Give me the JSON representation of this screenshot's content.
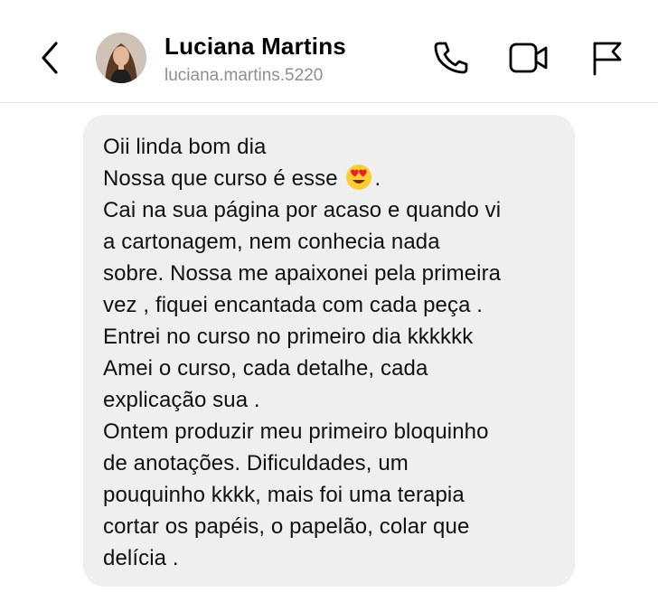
{
  "header": {
    "name": "Luciana Martins",
    "username": "luciana.martins.5220",
    "icons": [
      "chevron-left-icon",
      "phone-icon",
      "video-camera-icon",
      "flag-icon"
    ]
  },
  "message": {
    "lines": [
      "Oii linda bom dia",
      "Nossa que curso é esse",
      ".",
      "Cai na sua página por acaso e quando vi",
      "a cartonagem, nem conhecia nada",
      "sobre. Nossa me apaixonei pela primeira",
      "vez , fiquei encantada com cada peça .",
      "Entrei no curso no primeiro dia kkkkkk",
      "Amei o curso, cada detalhe, cada",
      "explicação sua .",
      "Ontem produzir meu primeiro bloquinho",
      "de anotações. Dificuldades, um",
      "pouquinho kkkk, mais foi uma terapia",
      "cortar os papéis, o papelão, colar que",
      "delícia ."
    ],
    "emoji": "heart-eyes-emoji",
    "bubble_color": "#efefef"
  }
}
